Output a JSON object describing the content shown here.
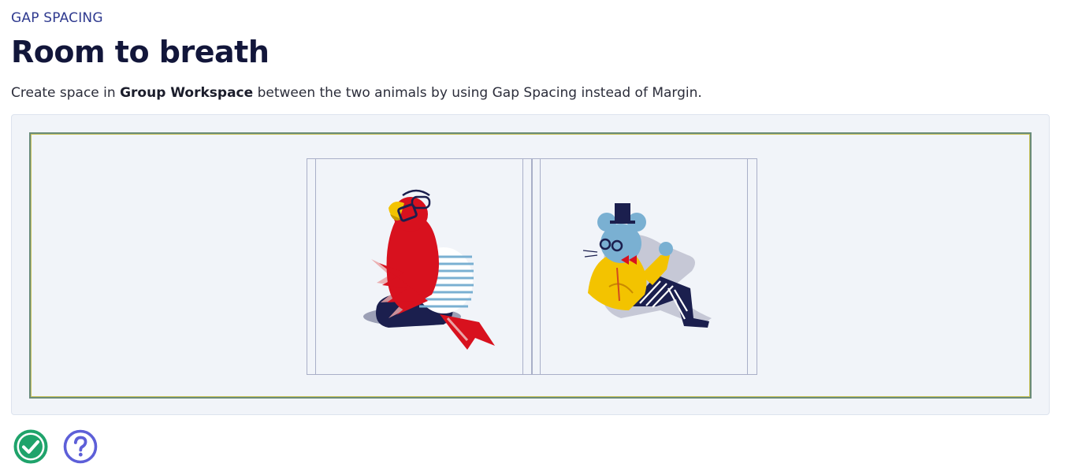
{
  "lesson": {
    "category": "GAP SPACING",
    "title": "Room to breath",
    "instruction_before": "Create space in ",
    "instruction_bold": "Group Workspace",
    "instruction_after": " between the two animals by using Gap Spacing instead of Margin."
  },
  "workspace": {
    "animals": [
      {
        "name": "parrot",
        "icon": "parrot-illustration"
      },
      {
        "name": "mouse",
        "icon": "mouse-illustration"
      }
    ]
  },
  "actions": {
    "check_icon": "check-circle-icon",
    "help_icon": "question-circle-icon"
  },
  "colors": {
    "accent": "#2f3a8f",
    "check": "#1fa36b",
    "help": "#5d5fd8",
    "parrot_red": "#d8111e",
    "mouse_blue": "#7ab0d2",
    "jacket_yellow": "#f3c300"
  }
}
